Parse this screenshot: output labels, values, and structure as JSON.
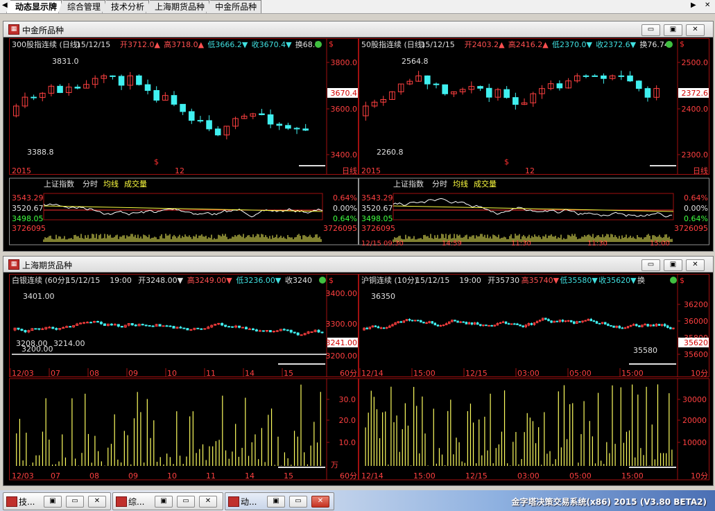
{
  "tabs": [
    "动态显示牌",
    "综合管理",
    "技术分析",
    "上海期货品种",
    "中金所品种"
  ],
  "panels": [
    {
      "title": "中金所品种"
    },
    {
      "title": "上海期货品种"
    }
  ],
  "window_buttons": {
    "minimize": "▭",
    "restore": "▣",
    "close": "✕"
  },
  "charts": {
    "if300": {
      "header": [
        {
          "text": "300股指连续 (日线)",
          "color": "#e0e0e0"
        },
        {
          "text": "15/12/15",
          "color": "#e0e0e0"
        },
        {
          "text": "开3712.0▲",
          "color": "#ff5050"
        },
        {
          "text": "高3718.0▲",
          "color": "#ff5050"
        },
        {
          "text": "低3666.2▼",
          "color": "#40e0e0"
        },
        {
          "text": "收3670.4▼",
          "color": "#40e0e0"
        },
        {
          "text": "换68.7",
          "color": "#e0e0e0"
        }
      ],
      "y_ticks": [
        "3800.0",
        "3600.0",
        "3400.0"
      ],
      "x_labels": [
        "2015",
        "12",
        "日线"
      ],
      "annotations": [
        "3831.0",
        "3388.8"
      ],
      "last_price": "3670.4",
      "sub": {
        "header": [
          "上证指数",
          "分时",
          "均线",
          "成交量"
        ],
        "left": [
          "3543.29",
          "3520.67",
          "3498.05",
          "3726095"
        ],
        "right": [
          "0.64%",
          "0.00%",
          "0.64%",
          "3726095"
        ]
      }
    },
    "ih50": {
      "header": [
        {
          "text": "50股指连续 (日线)",
          "color": "#e0e0e0"
        },
        {
          "text": "15/12/15",
          "color": "#e0e0e0"
        },
        {
          "text": "开2403.2▲",
          "color": "#ff5050"
        },
        {
          "text": "高2416.2▲",
          "color": "#ff5050"
        },
        {
          "text": "低2370.0▼",
          "color": "#40e0e0"
        },
        {
          "text": "收2372.6▼",
          "color": "#40e0e0"
        },
        {
          "text": "换76.74",
          "color": "#e0e0e0"
        }
      ],
      "y_ticks": [
        "2500.0",
        "2400.0",
        "2300.0"
      ],
      "x_labels": [
        "2015",
        "12",
        "日线"
      ],
      "annotations": [
        "2564.8",
        "2260.8"
      ],
      "last_price": "2372.6",
      "sub": {
        "header": [
          "上证指数",
          "分时",
          "均线",
          "成交量"
        ],
        "left": [
          "3543.29",
          "3520.67",
          "3498.05",
          "3726095"
        ],
        "right": [
          "0.64%",
          "0.00%",
          "0.64%",
          "3726095"
        ],
        "x_labels": [
          "12/15 09:30",
          "14:59",
          "11:30",
          "11:30",
          "15:00"
        ]
      }
    },
    "ag": {
      "header": [
        {
          "text": "白银连续 (60分)",
          "color": "#e0e0e0"
        },
        {
          "text": "15/12/15",
          "color": "#e0e0e0"
        },
        {
          "text": "19:00",
          "color": "#e0e0e0"
        },
        {
          "text": "开3248.00▼",
          "color": "#e0e0e0"
        },
        {
          "text": "高3249.00▼",
          "color": "#ff5050"
        },
        {
          "text": "低3236.00▼",
          "color": "#40e0e0"
        },
        {
          "text": "收3240",
          "color": "#e0e0e0"
        }
      ],
      "y_ticks": [
        "3400.00",
        "3300.00",
        "3200.00"
      ],
      "x_labels": [
        "12/03",
        "07",
        "08",
        "09",
        "10",
        "11",
        "14",
        "15",
        "60分"
      ],
      "annotations": [
        "3401.00",
        "3208.00",
        "3214.00",
        "3200.00"
      ],
      "last_price": "3241.00",
      "vol_ticks": [
        "30.0",
        "20.0",
        "10.0"
      ],
      "vol_unit": "万"
    },
    "cu": {
      "header": [
        {
          "text": "沪铜连续 (10分)",
          "color": "#e0e0e0"
        },
        {
          "text": "15/12/15",
          "color": "#e0e0e0"
        },
        {
          "text": "19:00",
          "color": "#e0e0e0"
        },
        {
          "text": "开35730",
          "color": "#e0e0e0"
        },
        {
          "text": "高35740▼",
          "color": "#ff5050"
        },
        {
          "text": "低35580▼",
          "color": "#40e0e0"
        },
        {
          "text": "收35620▼",
          "color": "#40e0e0"
        },
        {
          "text": "换",
          "color": "#e0e0e0"
        }
      ],
      "y_ticks": [
        "36200",
        "36000",
        "35800",
        "35600"
      ],
      "x_labels": [
        "12/14",
        "15:00",
        "12/15",
        "03:00",
        "05:00",
        "15:00",
        "10分"
      ],
      "annotations": [
        "36350",
        "35580"
      ],
      "last_price": "35620",
      "vol_ticks": [
        "30000",
        "20000",
        "10000"
      ]
    }
  },
  "taskbar": {
    "windows": [
      "技...",
      "综...",
      "动..."
    ],
    "brand": "金字塔决策交易系统(x86) 2015 (V3.80 BETA2)"
  },
  "colors": {
    "up": "#ff4040",
    "down": "#40f0f0",
    "grid": "#a01010",
    "volume": "#ffff60"
  }
}
